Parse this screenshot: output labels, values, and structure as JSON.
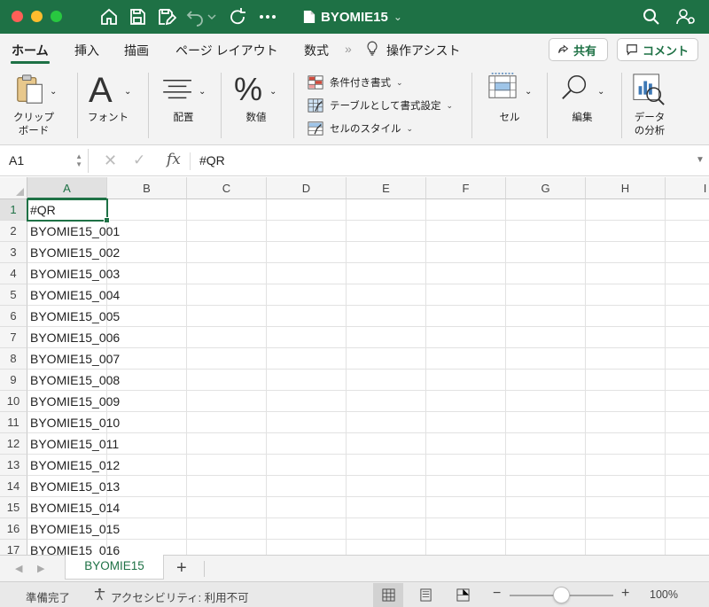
{
  "window": {
    "title": "BYOMIE15",
    "accent_color": "#1e7145"
  },
  "tabs": {
    "items": [
      "ホーム",
      "挿入",
      "描画",
      "ページ レイアウト",
      "数式"
    ],
    "more": "»",
    "assist": "操作アシスト",
    "share_label": "共有",
    "comment_label": "コメント"
  },
  "ribbon": {
    "clipboard": "クリップ\nボード",
    "font": "フォント",
    "alignment": "配置",
    "number": "数値",
    "conditional_format": "条件付き書式",
    "format_as_table": "テーブルとして書式設定",
    "cell_styles": "セルのスタイル",
    "cells": "セル",
    "editing": "編集",
    "analyze_data": "データ\nの分析"
  },
  "formula_bar": {
    "name_box": "A1",
    "value": "#QR"
  },
  "sheet": {
    "columns": [
      "A",
      "B",
      "C",
      "D",
      "E",
      "F",
      "G",
      "H",
      "I"
    ],
    "selected_cell": "A1",
    "rows": [
      {
        "num": "1",
        "a": "#QR"
      },
      {
        "num": "2",
        "a": "BYOMIE15_001"
      },
      {
        "num": "3",
        "a": "BYOMIE15_002"
      },
      {
        "num": "4",
        "a": "BYOMIE15_003"
      },
      {
        "num": "5",
        "a": "BYOMIE15_004"
      },
      {
        "num": "6",
        "a": "BYOMIE15_005"
      },
      {
        "num": "7",
        "a": "BYOMIE15_006"
      },
      {
        "num": "8",
        "a": "BYOMIE15_007"
      },
      {
        "num": "9",
        "a": "BYOMIE15_008"
      },
      {
        "num": "10",
        "a": "BYOMIE15_009"
      },
      {
        "num": "11",
        "a": "BYOMIE15_010"
      },
      {
        "num": "12",
        "a": "BYOMIE15_011"
      },
      {
        "num": "13",
        "a": "BYOMIE15_012"
      },
      {
        "num": "14",
        "a": "BYOMIE15_013"
      },
      {
        "num": "15",
        "a": "BYOMIE15_014"
      },
      {
        "num": "16",
        "a": "BYOMIE15_015"
      },
      {
        "num": "17",
        "a": "BYOMIE15_016"
      }
    ]
  },
  "sheet_tabs": {
    "active": "BYOMIE15",
    "add_label": "+"
  },
  "status": {
    "ready": "準備完了",
    "accessibility": "アクセシビリティ: 利用不可",
    "zoom_minus": "−",
    "zoom_plus": "+",
    "zoom": "100%",
    "zoom_level": 0.5
  }
}
